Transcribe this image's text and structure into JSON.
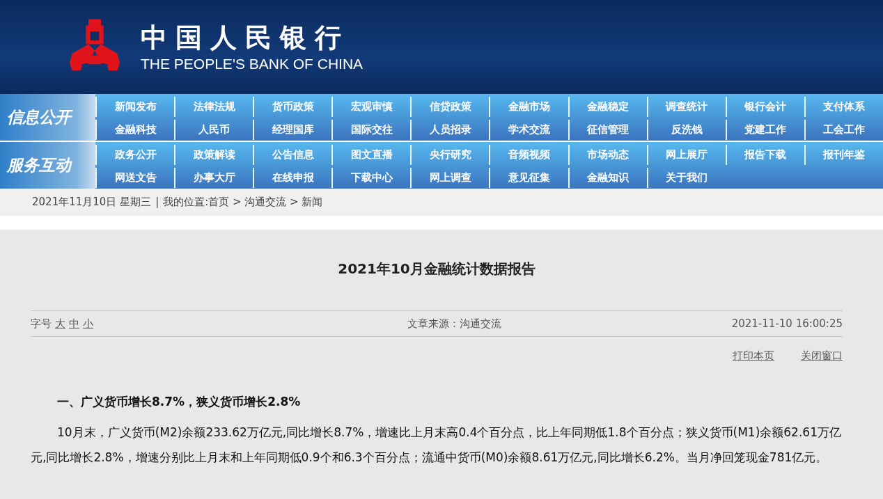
{
  "header": {
    "logo_cn": "中国人民银行",
    "logo_en": "THE PEOPLE'S BANK OF CHINA"
  },
  "nav_sections": [
    {
      "title": "信息公开",
      "items": [
        "新闻发布",
        "法律法规",
        "货币政策",
        "宏观审慎",
        "信贷政策",
        "金融市场",
        "金融稳定",
        "调查统计",
        "银行会计",
        "支付体系",
        "金融科技",
        "人民币",
        "经理国库",
        "国际交往",
        "人员招录",
        "学术交流",
        "征信管理",
        "反洗钱",
        "党建工作",
        "工会工作"
      ]
    },
    {
      "title": "服务互动",
      "items": [
        "政务公开",
        "政策解读",
        "公告信息",
        "图文直播",
        "央行研究",
        "音频视频",
        "市场动态",
        "网上展厅",
        "报告下载",
        "报刊年鉴",
        "网送文告",
        "办事大厅",
        "在线申报",
        "下载中心",
        "网上调查",
        "意见征集",
        "金融知识",
        "关于我们"
      ]
    }
  ],
  "breadcrumb": {
    "date": "2021年11月10日 星期三",
    "separator": "|",
    "location": "我的位置:首页 > 沟通交流 > 新闻"
  },
  "article": {
    "title": "2021年10月金融统计数据报告",
    "font_size_label": "字号",
    "font_sizes": [
      "大",
      "中",
      "小"
    ],
    "source": "文章来源：沟通交流",
    "datetime": "2021-11-10 16:00:25",
    "actions": [
      "打印本页",
      "关闭窗口"
    ],
    "heading": "一、广义货币增长8.7%，狭义货币增长2.8%",
    "paragraph": "10月末，广义货币(M2)余额233.62万亿元,同比增长8.7%，增速比上月末高0.4个百分点，比上年同期低1.8个百分点；狭义货币(M1)余额62.61万亿元,同比增长2.8%，增速分别比上月末和上年同期低0.9个和6.3个百分点；流通中货币(M0)余额8.61万亿元,同比增长6.2%。当月净回笼现金781亿元。"
  }
}
